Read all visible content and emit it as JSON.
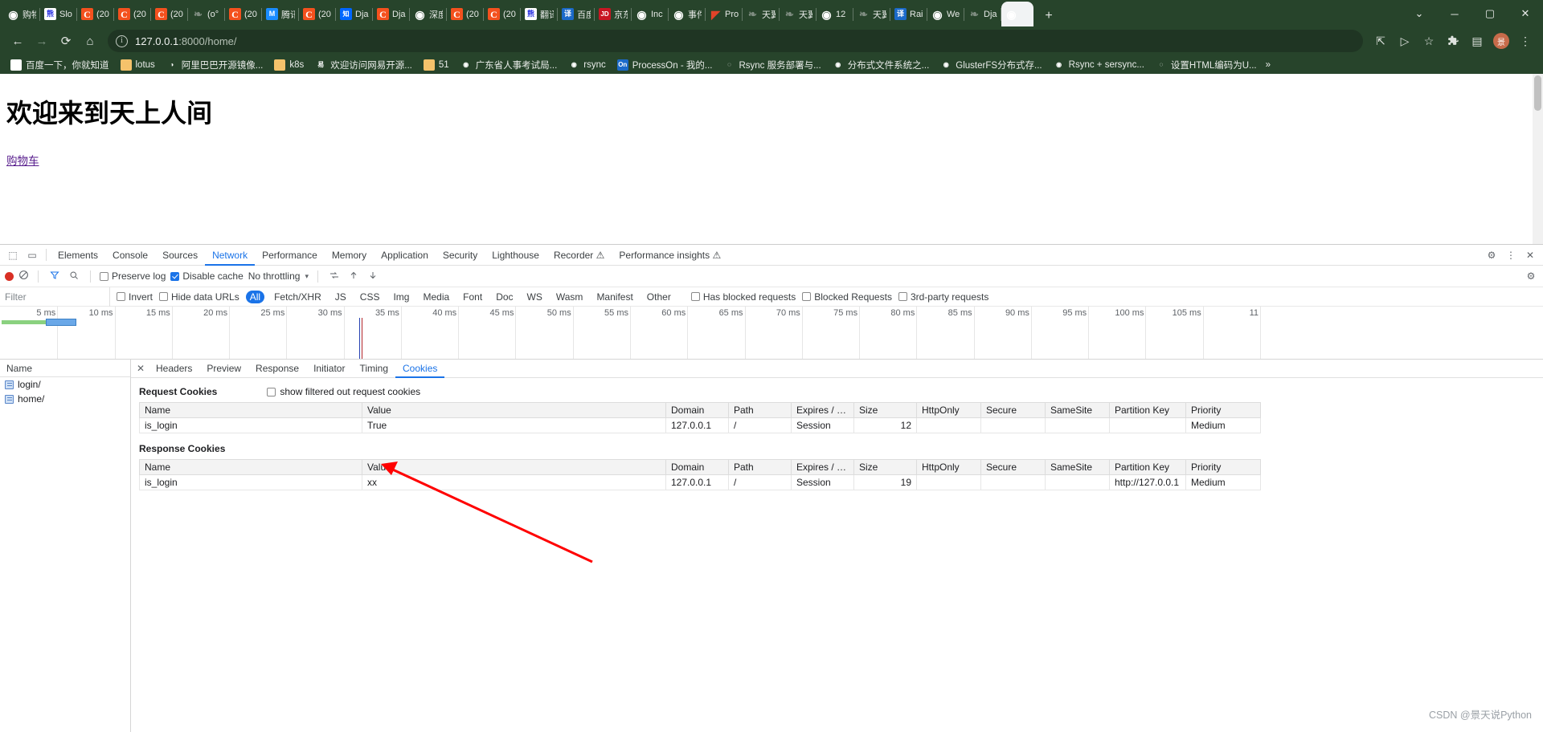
{
  "browser": {
    "tabs": [
      {
        "label": "购物",
        "icon": "globe-icon",
        "icon_class": "fv-globe"
      },
      {
        "label": "Slo",
        "icon": "baidu-icon",
        "icon_class": "fv-baidu"
      },
      {
        "label": "(20",
        "icon": "csdn-icon",
        "icon_class": "fv-c"
      },
      {
        "label": "(20",
        "icon": "csdn-icon",
        "icon_class": "fv-c"
      },
      {
        "label": "(20",
        "icon": "csdn-icon",
        "icon_class": "fv-c"
      },
      {
        "label": "(o°",
        "icon": "generic-page-icon",
        "icon_class": "fv-dim"
      },
      {
        "label": "(20",
        "icon": "csdn-icon",
        "icon_class": "fv-c"
      },
      {
        "label": "腾讯",
        "icon": "tencent-icon",
        "icon_class": "fv-tx"
      },
      {
        "label": "(20",
        "icon": "csdn-icon",
        "icon_class": "fv-c"
      },
      {
        "label": "Dja",
        "icon": "zhihu-icon",
        "icon_class": "fv-zhihu"
      },
      {
        "label": "Dja",
        "icon": "csdn-icon",
        "icon_class": "fv-c"
      },
      {
        "label": "深度",
        "icon": "globe-icon",
        "icon_class": "fv-globe"
      },
      {
        "label": "(20",
        "icon": "csdn-icon",
        "icon_class": "fv-c"
      },
      {
        "label": "(20",
        "icon": "csdn-icon",
        "icon_class": "fv-c"
      },
      {
        "label": "翻译",
        "icon": "baidu-icon",
        "icon_class": "fv-baidu"
      },
      {
        "label": "百度",
        "icon": "translate-icon",
        "icon_class": "fv-blue"
      },
      {
        "label": "京东",
        "icon": "jd-icon",
        "icon_class": "fv-jd"
      },
      {
        "label": "Inc",
        "icon": "globe-icon",
        "icon_class": "fv-globe"
      },
      {
        "label": "事件",
        "icon": "globe-icon",
        "icon_class": "fv-globe"
      },
      {
        "label": "Pro",
        "icon": "gitlab-icon",
        "icon_class": "fv-gl"
      },
      {
        "label": "天翼",
        "icon": "flower-icon",
        "icon_class": "fv-dim"
      },
      {
        "label": "天翼",
        "icon": "flower-icon",
        "icon_class": "fv-dim"
      },
      {
        "label": "12",
        "icon": "globe-icon",
        "icon_class": "fv-globe"
      },
      {
        "label": "天翼",
        "icon": "flower-icon",
        "icon_class": "fv-dim"
      },
      {
        "label": "Rai",
        "icon": "rancher-icon",
        "icon_class": "fv-blue"
      },
      {
        "label": "We",
        "icon": "globe-icon",
        "icon_class": "fv-globe"
      },
      {
        "label": "Dja",
        "icon": "generic-page-icon",
        "icon_class": "fv-dim"
      },
      {
        "label": "",
        "icon": "globe-icon",
        "icon_class": "fv-globe"
      }
    ],
    "new_tab_label": "+",
    "tab_search_label": "⌄",
    "window_controls": {
      "minimize": "─",
      "maximize": "▢",
      "close": "✕"
    },
    "nav": {
      "back": "←",
      "forward": "→",
      "reload": "⟳",
      "home": "⌂"
    },
    "omnibox": {
      "info_icon": "ⓘ",
      "url_host": "127.0.0.1",
      "url_path": ":8000/home/"
    },
    "toolbar_icons": {
      "share": "⇱",
      "cast": "▷",
      "bookmark_star": "☆",
      "extensions": "🧩",
      "sidepanel": "▤",
      "profile": "景",
      "menu": "⋮"
    },
    "bookmarks": [
      {
        "label": "百度一下，你就知道",
        "icon_class": "fv-baidu",
        "icon_text": "百",
        "icon_name": "baidu-icon"
      },
      {
        "label": "lotus",
        "icon_class": "bm-folder",
        "icon_text": "",
        "icon_name": "folder-icon"
      },
      {
        "label": "阿里巴巴开源镜像...",
        "icon_class": "fv-ali",
        "icon_text": "◑",
        "icon_name": "aliyun-icon"
      },
      {
        "label": "k8s",
        "icon_class": "bm-folder",
        "icon_text": "",
        "icon_name": "folder-icon"
      },
      {
        "label": "欢迎访问网易开源...",
        "icon_class": "fv-dim",
        "icon_text": "易",
        "icon_name": "netease-icon"
      },
      {
        "label": "51",
        "icon_class": "bm-folder",
        "icon_text": "",
        "icon_name": "folder-icon"
      },
      {
        "label": "广东省人事考试局...",
        "icon_class": "fv-globe",
        "icon_text": "◉",
        "icon_name": "globe-icon"
      },
      {
        "label": "rsync",
        "icon_class": "fv-globe",
        "icon_text": "◉",
        "icon_name": "globe-icon"
      },
      {
        "label": "ProcessOn - 我的...",
        "icon_class": "fv-blue",
        "icon_text": "On",
        "icon_name": "processon-icon"
      },
      {
        "label": "Rsync 服务部署与...",
        "icon_class": "fv-dim",
        "icon_text": "◌",
        "icon_name": "generic-page-icon"
      },
      {
        "label": "分布式文件系统之...",
        "icon_class": "fv-globe",
        "icon_text": "◉",
        "icon_name": "globe-icon"
      },
      {
        "label": "GlusterFS分布式存...",
        "icon_class": "fv-globe",
        "icon_text": "◉",
        "icon_name": "globe-icon"
      },
      {
        "label": "Rsync + sersync...",
        "icon_class": "fv-globe",
        "icon_text": "◉",
        "icon_name": "globe-icon"
      },
      {
        "label": "设置HTML编码为U...",
        "icon_class": "fv-dim",
        "icon_text": "◌",
        "icon_name": "generic-page-icon"
      }
    ],
    "bookmarks_overflow": "»"
  },
  "page": {
    "heading": "欢迎来到天上人间",
    "cart_link": "购物车"
  },
  "devtools": {
    "panel_tabs": [
      {
        "label": "Elements",
        "active": false
      },
      {
        "label": "Console",
        "active": false
      },
      {
        "label": "Sources",
        "active": false
      },
      {
        "label": "Network",
        "active": true
      },
      {
        "label": "Performance",
        "active": false
      },
      {
        "label": "Memory",
        "active": false
      },
      {
        "label": "Application",
        "active": false
      },
      {
        "label": "Security",
        "active": false
      },
      {
        "label": "Lighthouse",
        "active": false
      },
      {
        "label": "Recorder ⚠",
        "active": false
      },
      {
        "label": "Performance insights ⚠",
        "active": false
      }
    ],
    "inspect_icon": "⬚",
    "device_icon": "▭",
    "settings_icon": "⚙",
    "more_icon": "⋮",
    "close_icon": "✕",
    "network_toolbar": {
      "record_label": "record",
      "clear_label": "clear",
      "filter_icon": "▼",
      "search_icon": "🔍",
      "preserve_log": "Preserve log",
      "preserve_log_checked": false,
      "disable_cache": "Disable cache",
      "disable_cache_checked": true,
      "throttling": "No throttling",
      "throttling_caret": "▾",
      "wifi_icon": "⇅",
      "import_icon": "↑",
      "export_icon": "↓",
      "settings_icon": "⚙"
    },
    "filter_bar": {
      "placeholder": "Filter",
      "invert": "Invert",
      "hide_data_urls": "Hide data URLs",
      "types": [
        "All",
        "Fetch/XHR",
        "JS",
        "CSS",
        "Img",
        "Media",
        "Font",
        "Doc",
        "WS",
        "Wasm",
        "Manifest",
        "Other"
      ],
      "selected_type": "All",
      "has_blocked_requests": "Has blocked requests",
      "blocked_requests": "Blocked Requests",
      "third_party_requests": "3rd-party requests"
    },
    "overview_ticks": [
      "5 ms",
      "10 ms",
      "15 ms",
      "20 ms",
      "25 ms",
      "30 ms",
      "35 ms",
      "40 ms",
      "45 ms",
      "50 ms",
      "55 ms",
      "60 ms",
      "65 ms",
      "70 ms",
      "75 ms",
      "80 ms",
      "85 ms",
      "90 ms",
      "95 ms",
      "100 ms",
      "105 ms",
      "11"
    ],
    "requests_header": "Name",
    "requests": [
      {
        "name": "login/"
      },
      {
        "name": "home/"
      }
    ],
    "detail_tabs": [
      {
        "label": "Headers",
        "active": false
      },
      {
        "label": "Preview",
        "active": false
      },
      {
        "label": "Response",
        "active": false
      },
      {
        "label": "Initiator",
        "active": false
      },
      {
        "label": "Timing",
        "active": false
      },
      {
        "label": "Cookies",
        "active": true
      }
    ],
    "cookies": {
      "request_title": "Request Cookies",
      "show_filtered_label": "show filtered out request cookies",
      "show_filtered_checked": false,
      "response_title": "Response Cookies",
      "columns": [
        "Name",
        "Value",
        "Domain",
        "Path",
        "Expires / Max-...",
        "Size",
        "HttpOnly",
        "Secure",
        "SameSite",
        "Partition Key",
        "Priority"
      ],
      "request_rows": [
        {
          "Name": "is_login",
          "Value": "True",
          "Domain": "127.0.0.1",
          "Path": "/",
          "Expires": "Session",
          "Size": "12",
          "HttpOnly": "",
          "Secure": "",
          "SameSite": "",
          "PartitionKey": "",
          "Priority": "Medium"
        }
      ],
      "response_rows": [
        {
          "Name": "is_login",
          "Value": "xx",
          "Domain": "127.0.0.1",
          "Path": "/",
          "Expires": "Session",
          "Size": "19",
          "HttpOnly": "",
          "Secure": "",
          "SameSite": "",
          "PartitionKey": "http://127.0.0.1",
          "Priority": "Medium"
        }
      ]
    }
  },
  "annotation": {
    "arrow_color": "#ff0000",
    "watermark": "CSDN @景天说Python"
  }
}
